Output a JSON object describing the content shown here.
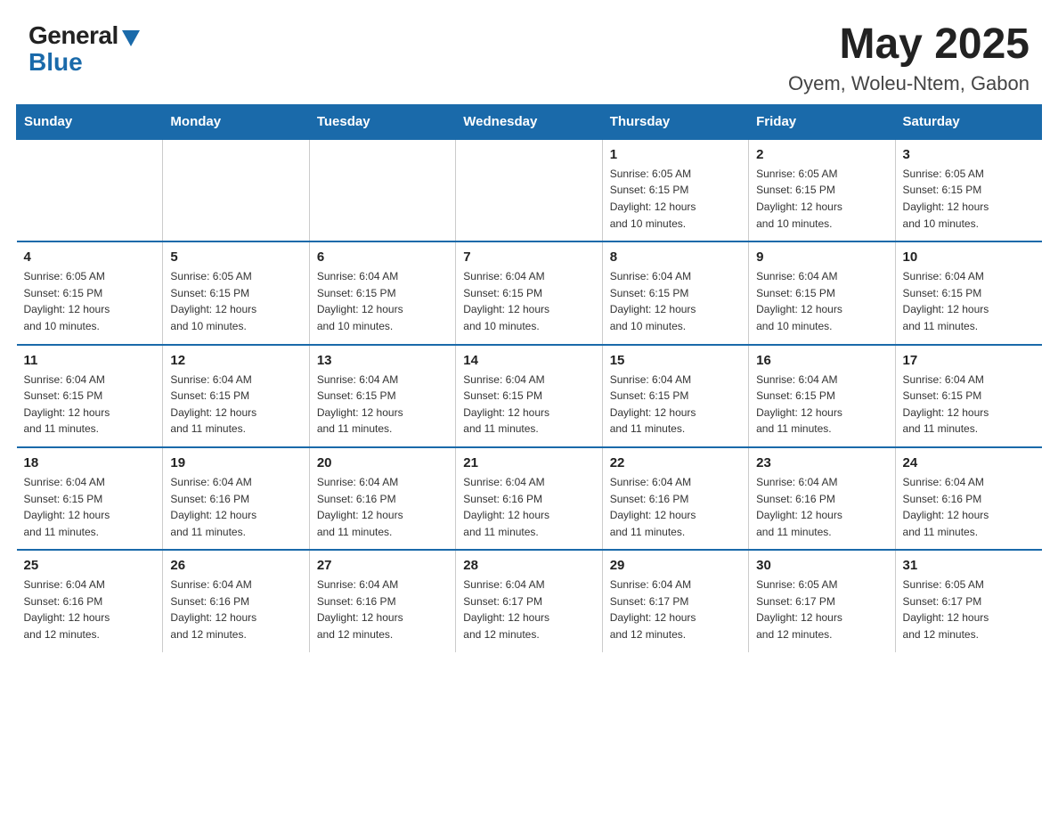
{
  "header": {
    "logo_general": "General",
    "logo_blue": "Blue",
    "title": "May 2025",
    "location": "Oyem, Woleu-Ntem, Gabon"
  },
  "days_of_week": [
    "Sunday",
    "Monday",
    "Tuesday",
    "Wednesday",
    "Thursday",
    "Friday",
    "Saturday"
  ],
  "weeks": [
    [
      {
        "day": "",
        "info": ""
      },
      {
        "day": "",
        "info": ""
      },
      {
        "day": "",
        "info": ""
      },
      {
        "day": "",
        "info": ""
      },
      {
        "day": "1",
        "info": "Sunrise: 6:05 AM\nSunset: 6:15 PM\nDaylight: 12 hours\nand 10 minutes."
      },
      {
        "day": "2",
        "info": "Sunrise: 6:05 AM\nSunset: 6:15 PM\nDaylight: 12 hours\nand 10 minutes."
      },
      {
        "day": "3",
        "info": "Sunrise: 6:05 AM\nSunset: 6:15 PM\nDaylight: 12 hours\nand 10 minutes."
      }
    ],
    [
      {
        "day": "4",
        "info": "Sunrise: 6:05 AM\nSunset: 6:15 PM\nDaylight: 12 hours\nand 10 minutes."
      },
      {
        "day": "5",
        "info": "Sunrise: 6:05 AM\nSunset: 6:15 PM\nDaylight: 12 hours\nand 10 minutes."
      },
      {
        "day": "6",
        "info": "Sunrise: 6:04 AM\nSunset: 6:15 PM\nDaylight: 12 hours\nand 10 minutes."
      },
      {
        "day": "7",
        "info": "Sunrise: 6:04 AM\nSunset: 6:15 PM\nDaylight: 12 hours\nand 10 minutes."
      },
      {
        "day": "8",
        "info": "Sunrise: 6:04 AM\nSunset: 6:15 PM\nDaylight: 12 hours\nand 10 minutes."
      },
      {
        "day": "9",
        "info": "Sunrise: 6:04 AM\nSunset: 6:15 PM\nDaylight: 12 hours\nand 10 minutes."
      },
      {
        "day": "10",
        "info": "Sunrise: 6:04 AM\nSunset: 6:15 PM\nDaylight: 12 hours\nand 11 minutes."
      }
    ],
    [
      {
        "day": "11",
        "info": "Sunrise: 6:04 AM\nSunset: 6:15 PM\nDaylight: 12 hours\nand 11 minutes."
      },
      {
        "day": "12",
        "info": "Sunrise: 6:04 AM\nSunset: 6:15 PM\nDaylight: 12 hours\nand 11 minutes."
      },
      {
        "day": "13",
        "info": "Sunrise: 6:04 AM\nSunset: 6:15 PM\nDaylight: 12 hours\nand 11 minutes."
      },
      {
        "day": "14",
        "info": "Sunrise: 6:04 AM\nSunset: 6:15 PM\nDaylight: 12 hours\nand 11 minutes."
      },
      {
        "day": "15",
        "info": "Sunrise: 6:04 AM\nSunset: 6:15 PM\nDaylight: 12 hours\nand 11 minutes."
      },
      {
        "day": "16",
        "info": "Sunrise: 6:04 AM\nSunset: 6:15 PM\nDaylight: 12 hours\nand 11 minutes."
      },
      {
        "day": "17",
        "info": "Sunrise: 6:04 AM\nSunset: 6:15 PM\nDaylight: 12 hours\nand 11 minutes."
      }
    ],
    [
      {
        "day": "18",
        "info": "Sunrise: 6:04 AM\nSunset: 6:15 PM\nDaylight: 12 hours\nand 11 minutes."
      },
      {
        "day": "19",
        "info": "Sunrise: 6:04 AM\nSunset: 6:16 PM\nDaylight: 12 hours\nand 11 minutes."
      },
      {
        "day": "20",
        "info": "Sunrise: 6:04 AM\nSunset: 6:16 PM\nDaylight: 12 hours\nand 11 minutes."
      },
      {
        "day": "21",
        "info": "Sunrise: 6:04 AM\nSunset: 6:16 PM\nDaylight: 12 hours\nand 11 minutes."
      },
      {
        "day": "22",
        "info": "Sunrise: 6:04 AM\nSunset: 6:16 PM\nDaylight: 12 hours\nand 11 minutes."
      },
      {
        "day": "23",
        "info": "Sunrise: 6:04 AM\nSunset: 6:16 PM\nDaylight: 12 hours\nand 11 minutes."
      },
      {
        "day": "24",
        "info": "Sunrise: 6:04 AM\nSunset: 6:16 PM\nDaylight: 12 hours\nand 11 minutes."
      }
    ],
    [
      {
        "day": "25",
        "info": "Sunrise: 6:04 AM\nSunset: 6:16 PM\nDaylight: 12 hours\nand 12 minutes."
      },
      {
        "day": "26",
        "info": "Sunrise: 6:04 AM\nSunset: 6:16 PM\nDaylight: 12 hours\nand 12 minutes."
      },
      {
        "day": "27",
        "info": "Sunrise: 6:04 AM\nSunset: 6:16 PM\nDaylight: 12 hours\nand 12 minutes."
      },
      {
        "day": "28",
        "info": "Sunrise: 6:04 AM\nSunset: 6:17 PM\nDaylight: 12 hours\nand 12 minutes."
      },
      {
        "day": "29",
        "info": "Sunrise: 6:04 AM\nSunset: 6:17 PM\nDaylight: 12 hours\nand 12 minutes."
      },
      {
        "day": "30",
        "info": "Sunrise: 6:05 AM\nSunset: 6:17 PM\nDaylight: 12 hours\nand 12 minutes."
      },
      {
        "day": "31",
        "info": "Sunrise: 6:05 AM\nSunset: 6:17 PM\nDaylight: 12 hours\nand 12 minutes."
      }
    ]
  ]
}
